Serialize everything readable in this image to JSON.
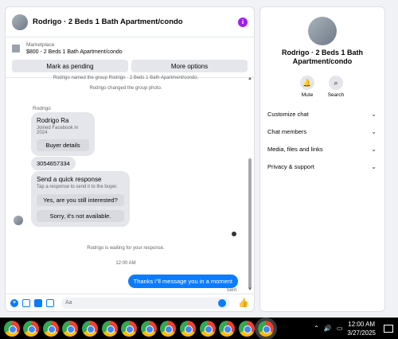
{
  "header": {
    "title": "Rodrigo · 2 Beds 1 Bath Apartment/condo",
    "info_icon": "i"
  },
  "listing": {
    "label": "Marketplace",
    "title": "$800 - 2 Beds 1 Bath Apartment/condo"
  },
  "actions": {
    "mark_pending": "Mark as pending",
    "more_options": "More options"
  },
  "messages": {
    "sys1": "Rodrigo named the group Rodrigo · 2 Beds 1 Bath Apartment/condo.",
    "sys2": "Rodrigo changed the group photo.",
    "sender": "Rodrigo",
    "profile": {
      "name": "Rodrigo Ra",
      "joined": "Joined Facebook in 2024",
      "button": "Buyer details"
    },
    "phone": "3054657334",
    "quick": {
      "title": "Send a quick response",
      "sub": "Tap a response to send it to the buyer.",
      "opt1": "Yes, are you still interested?",
      "opt2": "Sorry, it's not available."
    },
    "waiting": "Rodrigo is waiting for your response.",
    "time": "12:00 AM",
    "outgoing": "Thanks i\"ll message you in a moment",
    "status": "Sent"
  },
  "composer": {
    "placeholder": "Aa",
    "value": ""
  },
  "side": {
    "title": "Rodrigo · 2 Beds 1 Bath Apartment/condo",
    "mute": "Mute",
    "search": "Search",
    "menu": [
      "Customize chat",
      "Chat members",
      "Media, files and links",
      "Privacy & support"
    ]
  },
  "taskbar": {
    "time": "12:00 AM",
    "date": "3/27/2025"
  },
  "colors": {
    "accent": "#0a7cff",
    "info": "#a020f0"
  }
}
